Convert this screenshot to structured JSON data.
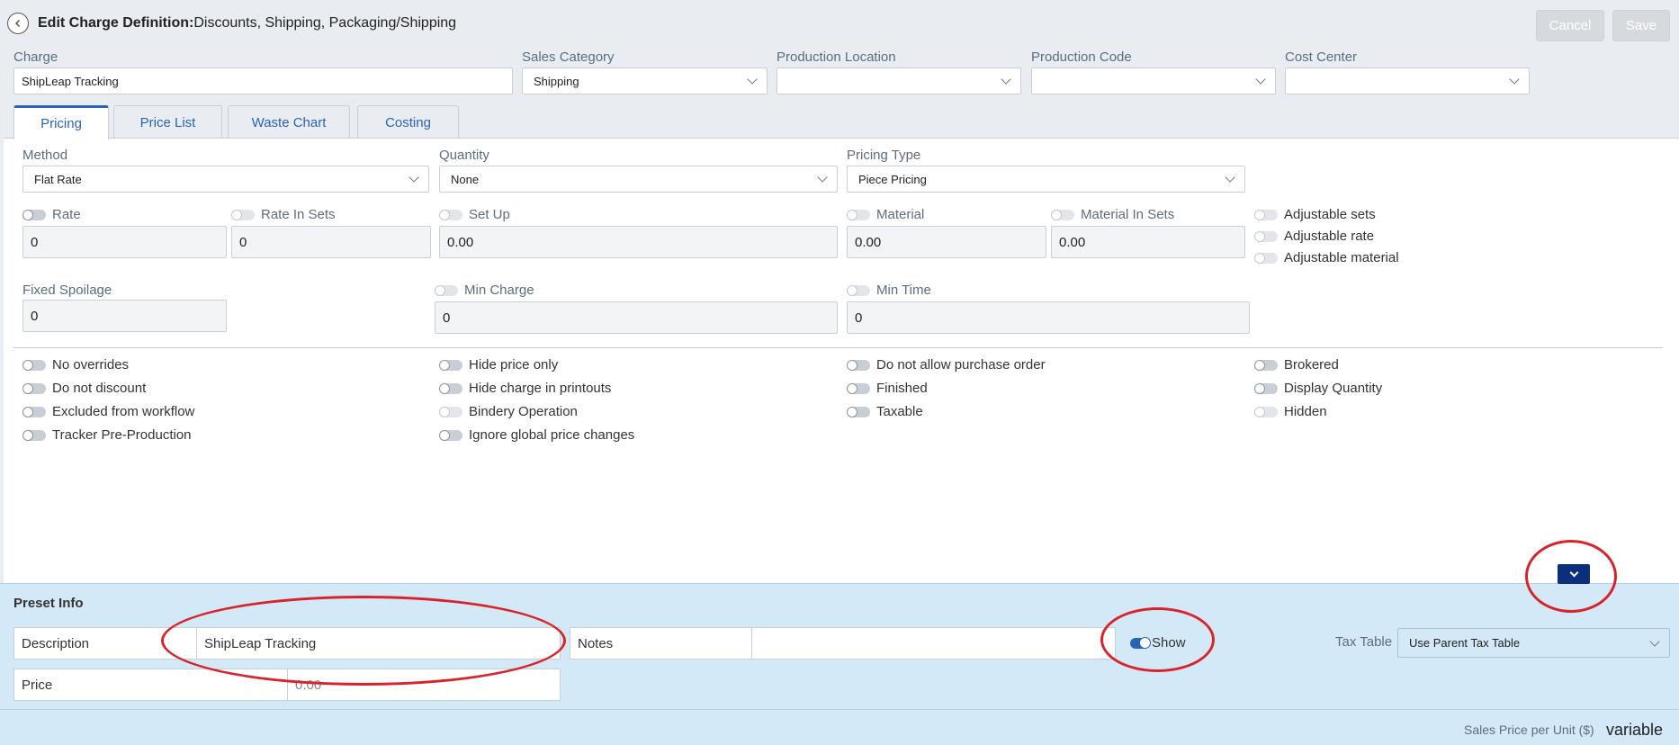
{
  "header": {
    "title_bold": "Edit Charge Definition:",
    "title_path": "Discounts, Shipping, Packaging/Shipping",
    "cancel_label": "Cancel",
    "save_label": "Save"
  },
  "top_fields": {
    "charge": {
      "label": "Charge",
      "value": "ShipLeap Tracking"
    },
    "sales_category": {
      "label": "Sales Category",
      "value": "Shipping"
    },
    "production_location": {
      "label": "Production Location",
      "value": ""
    },
    "production_code": {
      "label": "Production Code",
      "value": ""
    },
    "cost_center": {
      "label": "Cost Center",
      "value": ""
    }
  },
  "tabs": [
    {
      "label": "Pricing",
      "active": true
    },
    {
      "label": "Price List"
    },
    {
      "label": "Waste Chart"
    },
    {
      "label": "Costing"
    }
  ],
  "pricing": {
    "method": {
      "label": "Method",
      "value": "Flat Rate"
    },
    "quantity": {
      "label": "Quantity",
      "value": "None"
    },
    "pricing_type": {
      "label": "Pricing Type",
      "value": "Piece Pricing"
    },
    "rate": {
      "label": "Rate",
      "value": "0"
    },
    "rate_in_sets": {
      "label": "Rate In Sets",
      "value": "0"
    },
    "set_up": {
      "label": "Set Up",
      "value": "0.00"
    },
    "material": {
      "label": "Material",
      "value": "0.00"
    },
    "material_in_sets": {
      "label": "Material In Sets",
      "value": "0.00"
    },
    "adjustable": [
      "Adjustable sets",
      "Adjustable rate",
      "Adjustable material"
    ],
    "fixed_spoilage": {
      "label": "Fixed Spoilage",
      "value": "0"
    },
    "min_charge": {
      "label": "Min Charge",
      "value": "0"
    },
    "min_time": {
      "label": "Min Time",
      "value": "0"
    }
  },
  "options": {
    "col1": [
      "No overrides",
      "Do not discount",
      "Excluded from workflow",
      "Tracker Pre-Production"
    ],
    "col2": [
      "Hide price only",
      "Hide charge in printouts",
      "Bindery Operation",
      "Ignore global price changes"
    ],
    "col3": [
      "Do not allow purchase order",
      "Finished",
      "Taxable"
    ],
    "col4": [
      "Brokered",
      "Display Quantity",
      "Hidden"
    ]
  },
  "preset": {
    "title": "Preset Info",
    "description_label": "Description",
    "description_value": "ShipLeap Tracking",
    "notes_label": "Notes",
    "notes_value": "",
    "show_label": "Show",
    "tax_table_label": "Tax Table",
    "tax_table_value": "Use Parent Tax Table",
    "price_label": "Price",
    "price_value": "0.00",
    "sales_price_label": "Sales Price per Unit ($)",
    "sales_price_value": "variable"
  },
  "colors": {
    "accent": "#2a63b5",
    "annotation": "#d9232a",
    "preset_bg": "#d4e9f8"
  }
}
